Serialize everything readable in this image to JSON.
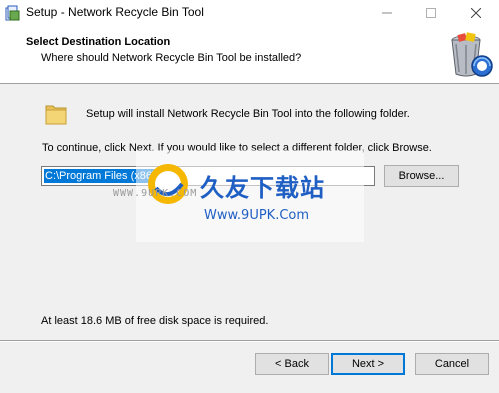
{
  "window": {
    "title": "Setup - Network Recycle Bin Tool",
    "controls": {
      "minimize": "—",
      "maximize": "☐",
      "close": "✕"
    }
  },
  "header": {
    "title": "Select Destination Location",
    "subtitle": "Where should Network Recycle Bin Tool be installed?",
    "logo_icon": "recycle-bin-icon"
  },
  "body": {
    "folder_icon": "folder-icon",
    "install_text": "Setup will install Network Recycle Bin Tool into the following folder.",
    "continue_text": "To continue, click Next. If you would like to select a different folder, click Browse.",
    "path_value": "C:\\Program Files (x86)\\Network Recycle Bin Tool",
    "browse_label": "Browse...",
    "space_text": "At least 18.6 MB of free disk space is required."
  },
  "footer": {
    "back_label": "< Back",
    "next_label": "Next >",
    "cancel_label": "Cancel"
  },
  "watermark": {
    "cn_text": "久友下载站",
    "url": "Www.9UPK.Com",
    "ghost": "WWW.9UPK.COM"
  },
  "colors": {
    "accent": "#0078d7",
    "watermark": "#1f5fc4"
  }
}
